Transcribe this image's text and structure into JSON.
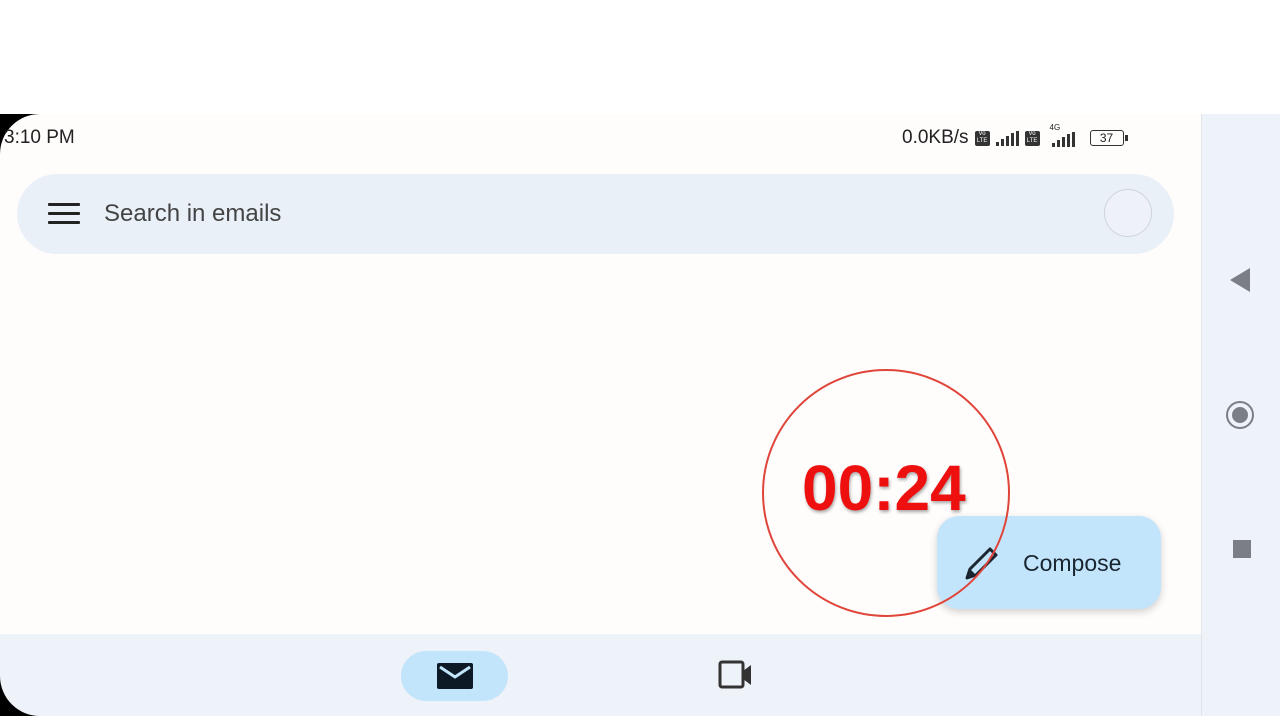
{
  "status_bar": {
    "time": "3:10 PM",
    "network_speed": "0.0KB/s",
    "volte_badge": "Vo LTE",
    "network_type": "4G",
    "battery": "37"
  },
  "search": {
    "placeholder": "Search in emails"
  },
  "compose": {
    "label": "Compose"
  },
  "recording_overlay": {
    "timer": "00:24",
    "color": "#ee0f0f"
  },
  "bottom_nav": {
    "tabs": [
      {
        "icon": "mail-icon",
        "active": true
      },
      {
        "icon": "video-icon",
        "active": false
      }
    ]
  },
  "colors": {
    "search_bg": "#eaf0f8",
    "compose_bg": "#c3e5fb",
    "active_tab_bg": "#c2e5fb"
  }
}
